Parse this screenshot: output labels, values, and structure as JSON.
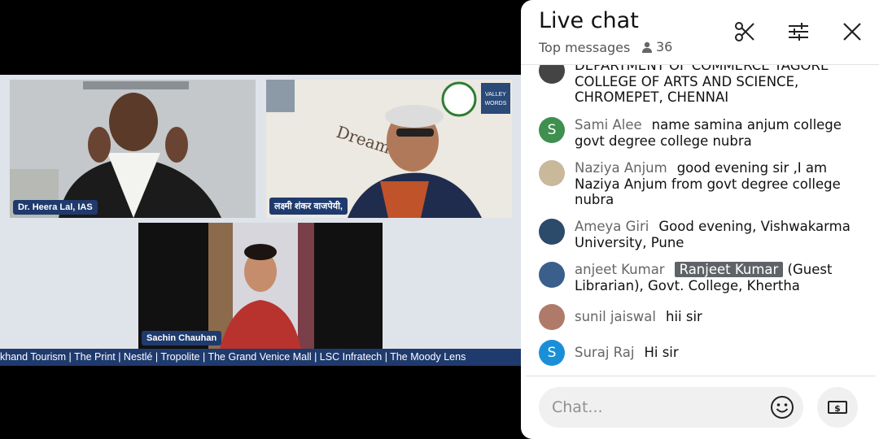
{
  "video": {
    "participants": [
      {
        "name": "Dr. Heera Lal, IAS"
      },
      {
        "name": "लक्ष्मी शंकर वाजपेयी,"
      },
      {
        "name": "Sachin Chauhan"
      }
    ],
    "ticker_text": "khand Tourism | The Print | Nestlé | Tropolite | The Grand Venice Mall | LSC Infratech | The Moody Lens",
    "logo_text_1": "VALLEY",
    "logo_text_2": "WORDS",
    "wall_text": "Dream"
  },
  "chat": {
    "title": "Live chat",
    "subtitle": "Top messages",
    "viewer_count": "36",
    "input_placeholder": "Chat...",
    "messages": [
      {
        "author": "",
        "text": "DEPARTMENT OF COMMERCE TAGORE COLLEGE OF ARTS AND SCIENCE, CHROMEPET, CHENNAI"
      },
      {
        "author": "Sami Alee",
        "avatar_letter": "S",
        "avatar_color": "#3f8f4f",
        "text": "name samina anjum college govt degree college nubra"
      },
      {
        "author": "Naziya Anjum",
        "avatar_color": "#c9b89a",
        "text": "good evening sir ,I am Naziya Anjum from govt degree college nubra"
      },
      {
        "author": "Ameya Giri",
        "avatar_color": "#2c4a6a",
        "text": "Good evening, Vishwakarma University, Pune"
      },
      {
        "author": "anjeet Kumar",
        "avatar_color": "#3a5f8a",
        "mention": "Ranjeet Kumar",
        "text": "(Guest Librarian), Govt. College, Khertha"
      },
      {
        "author": "sunil jaiswal",
        "avatar_color": "#b07a6a",
        "text": "hii sir"
      },
      {
        "author": "Suraj Raj",
        "avatar_letter": "S",
        "avatar_color": "#1a8fd8",
        "text": "Hi sir"
      }
    ]
  }
}
